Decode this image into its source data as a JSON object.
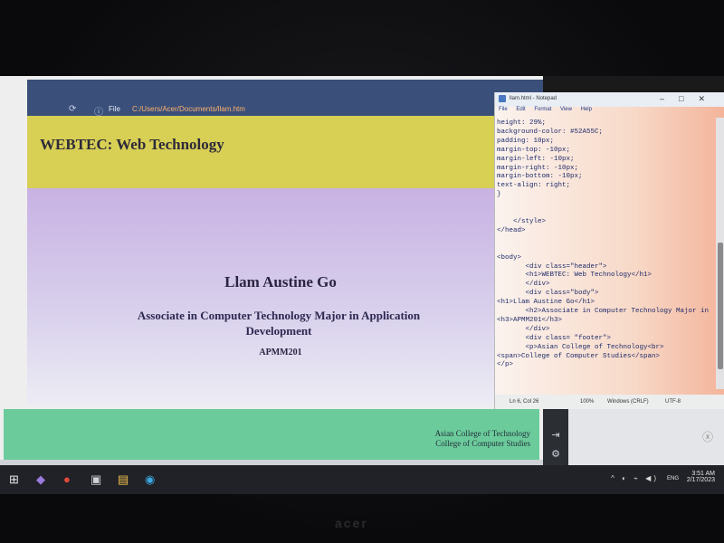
{
  "browser": {
    "file_label": "File",
    "url": "C:/Users/Acer/Documents/llam.htm"
  },
  "page": {
    "header_title": "WEBTEC: Web Technology",
    "name": "Llam Austine Go",
    "program": "Associate in Computer Technology Major in Application Development",
    "code": "APMM201",
    "footer_line1": "Asian College of Technology",
    "footer_line2": "College of Computer Studies"
  },
  "notepad": {
    "title": "llam.html - Notepad",
    "menu": [
      "File",
      "Edit",
      "Format",
      "View",
      "Help"
    ],
    "code": "height: 29%;\nbackground-color: #52A55C;\npadding: 10px;\nmargin-top: -10px;\nmargin-left: -10px;\nmargin-right: -10px;\nmargin-bottom: -10px;\ntext-align: right;\n}\n\n\n    </style>\n</head>\n\n\n<body>\n       <div class=\"header\">\n       <h1>WEBTEC: Web Technology</h1>\n       </div>\n       <div class=\"body\">\n<h1>Llam Austine Go</h1>\n       <h2>Associate in Computer Technology Major in\n<h3>APMM201</h3>\n       </div>\n       <div class= \"footer\">\n       <p>Asian College of Technology<br>\n<span>College of Computer Studies</span>\n</p>",
    "status": {
      "position": "Ln 6, Col 26",
      "zoom": "100%",
      "line_ending": "Windows (CRLF)",
      "encoding": "UTF-8"
    }
  },
  "taskbar": {
    "language": "ENG",
    "time": "3:51 AM",
    "date": "2/17/2023"
  },
  "bezel": {
    "brand": "acer"
  },
  "colors": {
    "header_bg": "#d8cf55",
    "body_bg": "#c8b2e3",
    "footer_bg": "#6ccb9b",
    "taskbar_bg": "#202227"
  }
}
